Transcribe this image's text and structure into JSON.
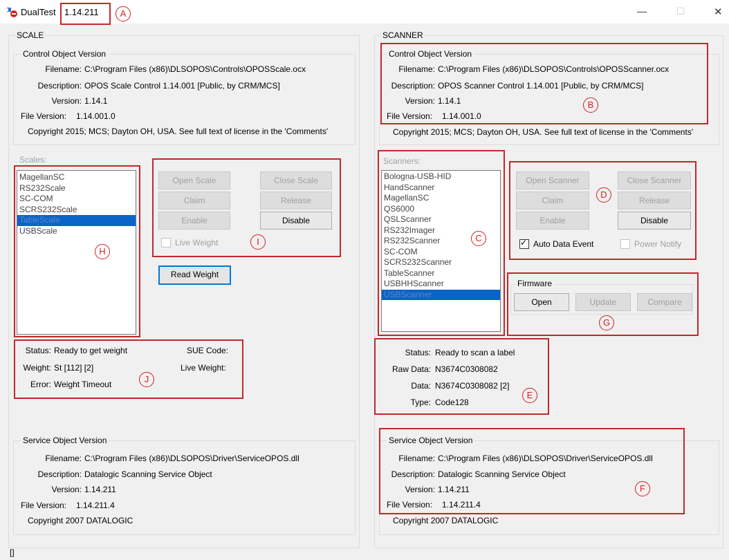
{
  "window": {
    "title": "DualTest",
    "version": "1.14.211",
    "controls": {
      "minimize": "—",
      "maximize": "☐",
      "close": "✕"
    }
  },
  "scale": {
    "section_title": "SCALE",
    "control_object": {
      "group_title": "Control Object Version",
      "filename_label": "Filename:",
      "filename": "C:\\Program Files (x86)\\DLSOPOS\\Controls\\OPOSScale.ocx",
      "description_label": "Description:",
      "description": "OPOS Scale Control 1.14.001 [Public, by CRM/MCS]",
      "version_label": "Version:",
      "version": "1.14.1",
      "file_version_label": "File Version:",
      "file_version": "1.14.001.0",
      "copyright": "Copyright 2015; MCS; Dayton OH, USA. See full text of license in the 'Comments'"
    },
    "list_label": "Scales:",
    "devices": [
      "MagellanSC",
      "RS232Scale",
      "SC-COM",
      "SCRS232Scale",
      "TableScale",
      "USBScale"
    ],
    "selected": "TableScale",
    "buttons": {
      "open": "Open Scale",
      "close": "Close Scale",
      "claim": "Claim",
      "release": "Release",
      "enable": "Enable",
      "disable": "Disable",
      "read_weight": "Read Weight"
    },
    "live_weight_checkbox": "Live Weight",
    "status": {
      "status_label": "Status:",
      "status": "Ready to get weight",
      "sue_label": "SUE Code:",
      "weight_label": "Weight:",
      "weight": "St [112] [2]",
      "live_weight_label": "Live Weight:",
      "error_label": "Error:",
      "error": "Weight Timeout"
    },
    "service_object": {
      "group_title": "Service Object Version",
      "filename_label": "Filename:",
      "filename": "C:\\Program Files (x86)\\DLSOPOS\\Driver\\ServiceOPOS.dll",
      "description_label": "Description:",
      "description": "Datalogic Scanning Service Object",
      "version_label": "Version:",
      "version": "1.14.211",
      "file_version_label": "File Version:",
      "file_version": "1.14.211.4",
      "copyright": "Copyright 2007 DATALOGIC"
    }
  },
  "scanner": {
    "section_title": "SCANNER",
    "control_object": {
      "group_title": "Control Object Version",
      "filename_label": "Filename:",
      "filename": "C:\\Program Files (x86)\\DLSOPOS\\Controls\\OPOSScanner.ocx",
      "description_label": "Description:",
      "description": "OPOS Scanner Control 1.14.001 [Public, by CRM/MCS]",
      "version_label": "Version:",
      "version": "1.14.1",
      "file_version_label": "File Version:",
      "file_version": "1.14.001.0",
      "copyright": "Copyright 2015; MCS; Dayton OH, USA. See full text of license in the 'Comments'"
    },
    "list_label": "Scanners:",
    "devices": [
      "Bologna-USB-HID",
      "HandScanner",
      "MagellanSC",
      "QS6000",
      "QSLScanner",
      "RS232Imager",
      "RS232Scanner",
      "SC-COM",
      "SCRS232Scanner",
      "TableScanner",
      "USBHHScanner",
      "USBScanner"
    ],
    "selected": "USBScanner",
    "buttons": {
      "open": "Open Scanner",
      "close": "Close Scanner",
      "claim": "Claim",
      "release": "Release",
      "enable": "Enable",
      "disable": "Disable"
    },
    "auto_data_event": "Auto Data Event",
    "power_notify": "Power Notify",
    "firmware": {
      "group_title": "Firmware",
      "open": "Open",
      "update": "Update",
      "compare": "Compare"
    },
    "status": {
      "status_label": "Status:",
      "status": "Ready to scan a label",
      "raw_label": "Raw Data:",
      "raw": "N3674C0308082",
      "data_label": "Data:",
      "data": "N3674C0308082 [2]",
      "type_label": "Type:",
      "type": "Code128"
    },
    "service_object": {
      "group_title": "Service Object Version",
      "filename_label": "Filename:",
      "filename": "C:\\Program Files (x86)\\DLSOPOS\\Driver\\ServiceOPOS.dll",
      "description_label": "Description:",
      "description": "Datalogic Scanning Service Object",
      "version_label": "Version:",
      "version": "1.14.211",
      "file_version_label": "File Version:",
      "file_version": "1.14.211.4",
      "copyright": "Copyright 2007 DATALOGIC"
    }
  },
  "annotations": [
    "A",
    "B",
    "C",
    "D",
    "E",
    "F",
    "G",
    "H",
    "I",
    "J"
  ],
  "status_bar": "[]"
}
